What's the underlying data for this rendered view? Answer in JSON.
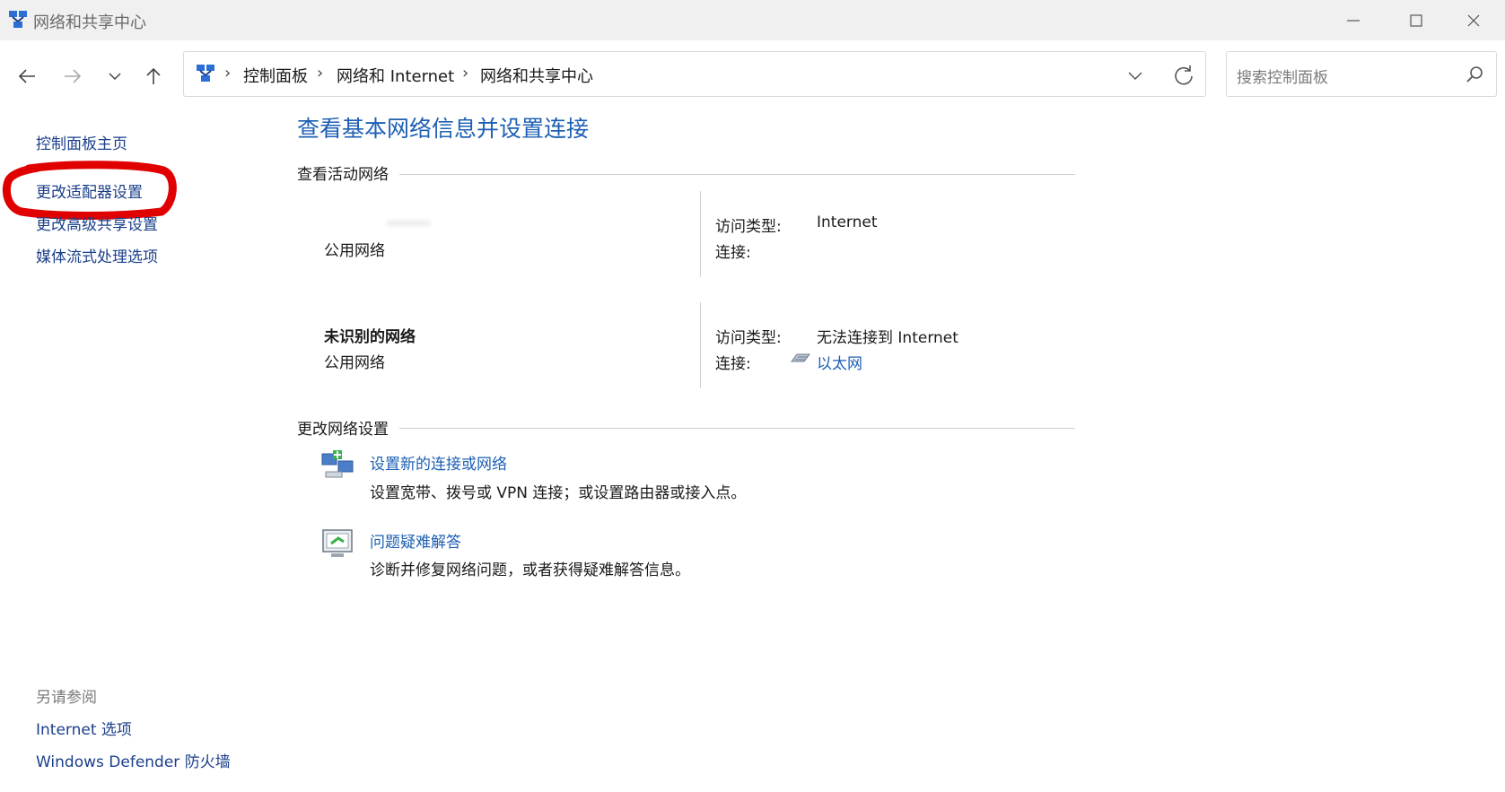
{
  "window": {
    "title": "网络和共享中心",
    "controls": {
      "minimize": "—",
      "maximize": "☐",
      "close": "✕"
    },
    "icon": "network-sharing-icon"
  },
  "nav": {
    "back_icon": "back-arrow-icon",
    "forward_icon": "forward-arrow-icon",
    "recent_icon": "chevron-down-icon",
    "up_icon": "up-arrow-icon"
  },
  "address": {
    "breadcrumbs": [
      "控制面板",
      "网络和 Internet",
      "网络和共享中心"
    ],
    "separator": "›"
  },
  "search": {
    "placeholder": "搜索控制面板"
  },
  "sidebar": {
    "items": [
      {
        "label": "控制面板主页"
      },
      {
        "label": "更改适配器设置"
      },
      {
        "label": "更改高级共享设置"
      },
      {
        "label": "媒体流式处理选项"
      }
    ],
    "see_also_heading": "另请参阅",
    "see_also": [
      {
        "label": "Internet 选项"
      },
      {
        "label": "Windows Defender 防火墙"
      }
    ]
  },
  "main": {
    "title": "查看基本网络信息并设置连接",
    "active_networks_heading": "查看活动网络",
    "networks": [
      {
        "name": "",
        "type": "公用网络",
        "access_type_label": "访问类型:",
        "access_type_value": "Internet",
        "connections_label": "连接:",
        "connection_value": ""
      },
      {
        "name": "未识别的网络",
        "type": "公用网络",
        "access_type_label": "访问类型:",
        "access_type_value": "无法连接到 Internet",
        "connections_label": "连接:",
        "connection_value": "以太网"
      }
    ],
    "change_settings_heading": "更改网络设置",
    "tasks": [
      {
        "link": "设置新的连接或网络",
        "description": "设置宽带、拨号或 VPN 连接；或设置路由器或接入点。",
        "icon": "new-connection-icon"
      },
      {
        "link": "问题疑难解答",
        "description": "诊断并修复网络问题，或者获得疑难解答信息。",
        "icon": "troubleshoot-icon"
      }
    ]
  },
  "colors": {
    "link": "#1d5fb3",
    "sidebar_link": "#1b3f8a",
    "annotation": "#e00000",
    "titlebar": "#f0f0f0"
  }
}
